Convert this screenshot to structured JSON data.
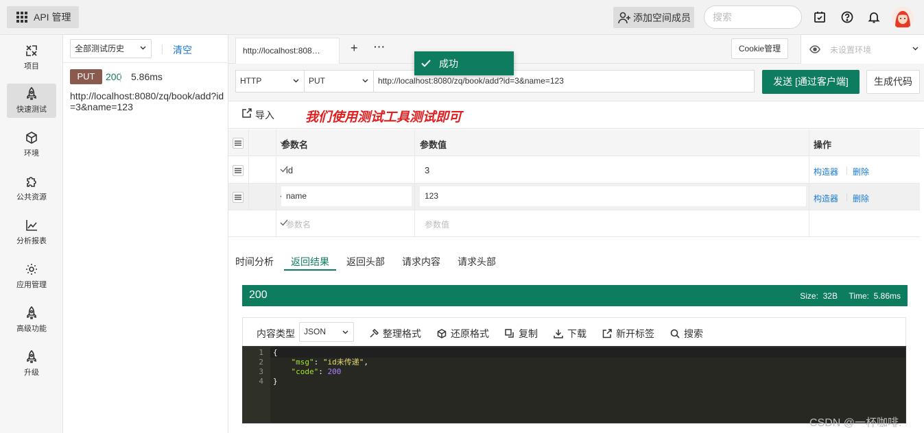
{
  "topbar": {
    "app_title": "API 管理",
    "add_member_label": "添加空间成员",
    "search_placeholder": "搜索",
    "icons": [
      "task-icon",
      "help-icon",
      "bell-icon",
      "avatar"
    ]
  },
  "nav": {
    "items": [
      {
        "label": "项目",
        "icon": "puzzle-icon"
      },
      {
        "label": "快速测试",
        "icon": "rocket-icon"
      },
      {
        "label": "环境",
        "icon": "cube-icon"
      },
      {
        "label": "公共资源",
        "icon": "extension-icon"
      },
      {
        "label": "分析报表",
        "icon": "chart-icon"
      },
      {
        "label": "应用管理",
        "icon": "gear-icon"
      },
      {
        "label": "高级功能",
        "icon": "rocket-icon"
      },
      {
        "label": "升级",
        "icon": "rocket-icon"
      }
    ],
    "active_index": 1
  },
  "history": {
    "filter_value": "全部测试历史",
    "clear_label": "清空",
    "entry": {
      "method": "PUT",
      "status": "200",
      "time": "5.86ms",
      "url": "http://localhost:8080/zq/book/add?id=3&name=123"
    }
  },
  "tabs": {
    "active_tab": "http://localhost:808…",
    "add": "+",
    "more": "···",
    "cookie_label": "Cookie管理",
    "env_placeholder": "未设置环境"
  },
  "toast": {
    "text": "成功"
  },
  "request": {
    "protocol": "HTTP",
    "method": "PUT",
    "url": "http://localhost:8080/zq/book/add?id=3&name=123",
    "send_label": "发送 [通过客户端]",
    "gen_code_label": "生成代码",
    "import_label": "导入",
    "annotation": "我们使用测试工具测试即可"
  },
  "params": {
    "headers": {
      "name": "参数名",
      "value": "参数值",
      "action": "操作"
    },
    "rows": [
      {
        "name": "id",
        "value": "3",
        "builder": "构造器",
        "delete": "删除"
      },
      {
        "name": "name",
        "value": "123",
        "builder": "构造器",
        "delete": "删除"
      }
    ],
    "new_row": {
      "name_placeholder": "参数名",
      "value_placeholder": "参数值"
    }
  },
  "response": {
    "tabs": [
      "时间分析",
      "返回结果",
      "返回头部",
      "请求内容",
      "请求头部"
    ],
    "active_tab": 1,
    "status_code": "200",
    "meta": "Size:  32B     Time:  5.86ms",
    "toolbar": {
      "content_type_label": "内容类型",
      "content_type": "JSON",
      "format": "整理格式",
      "restore": "还原格式",
      "copy": "复制",
      "download": "下载",
      "new_tab": "新开标签",
      "search": "搜索"
    },
    "body_lines": [
      "{",
      "    \"msg\": \"id未传递\",",
      "    \"code\": 200",
      "}"
    ],
    "msg_key": "\"msg\"",
    "msg_value": "\"id未传递\"",
    "code_key": "\"code\"",
    "code_value": "200"
  },
  "watermark": "CSDN @一杯咖啡."
}
